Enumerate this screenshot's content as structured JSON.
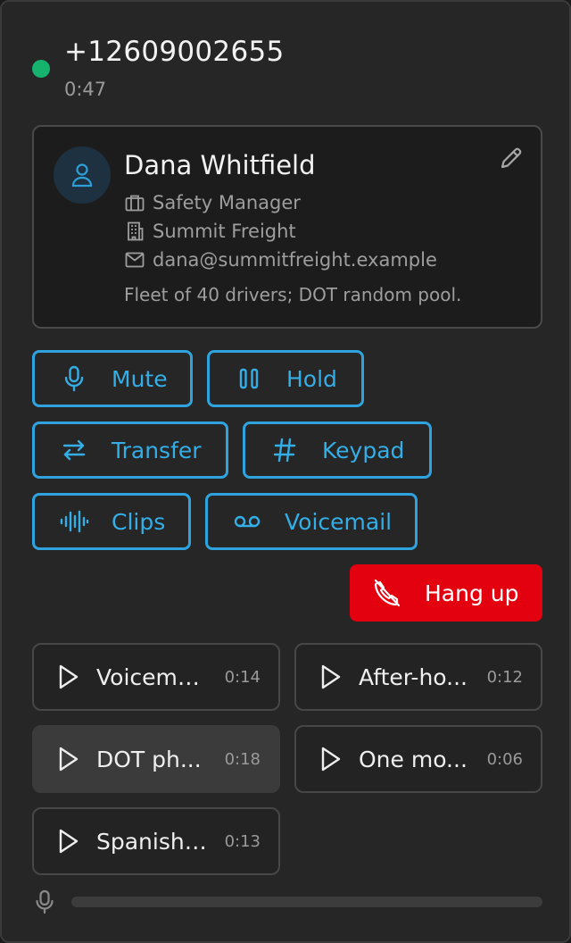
{
  "call": {
    "phone_number": "+12609002655",
    "duration": "0:47",
    "status_color": "#16b36e"
  },
  "contact": {
    "name": "Dana Whitfield",
    "title": "Safety Manager",
    "company": "Summit Freight",
    "email": "dana@summitfreight.example",
    "note": "Fleet of 40 drivers; DOT random pool.",
    "icons": [
      "user-icon",
      "briefcase-icon",
      "building-icon",
      "mail-icon",
      "pencil-icon"
    ]
  },
  "actions": {
    "mute": "Mute",
    "hold": "Hold",
    "transfer": "Transfer",
    "keypad": "Keypad",
    "clips": "Clips",
    "voicemail": "Voicemail",
    "hangup": "Hang up",
    "accent_color": "#2ea3de",
    "hangup_color": "#e3000f"
  },
  "clips": [
    {
      "title": "Voicemail drop",
      "display": "Voicema...",
      "duration": "0:14",
      "active": false
    },
    {
      "title": "After-hours",
      "display": "After-ho...",
      "duration": "0:12",
      "active": false
    },
    {
      "title": "DOT phone script",
      "display": "DOT ph...",
      "duration": "0:18",
      "active": true
    },
    {
      "title": "One moment please",
      "display": "One mo...",
      "duration": "0:06",
      "active": false
    },
    {
      "title": "Spanish greeting",
      "display": "Spanish ...",
      "duration": "0:13",
      "active": false
    }
  ],
  "mic": {
    "level": 0
  }
}
